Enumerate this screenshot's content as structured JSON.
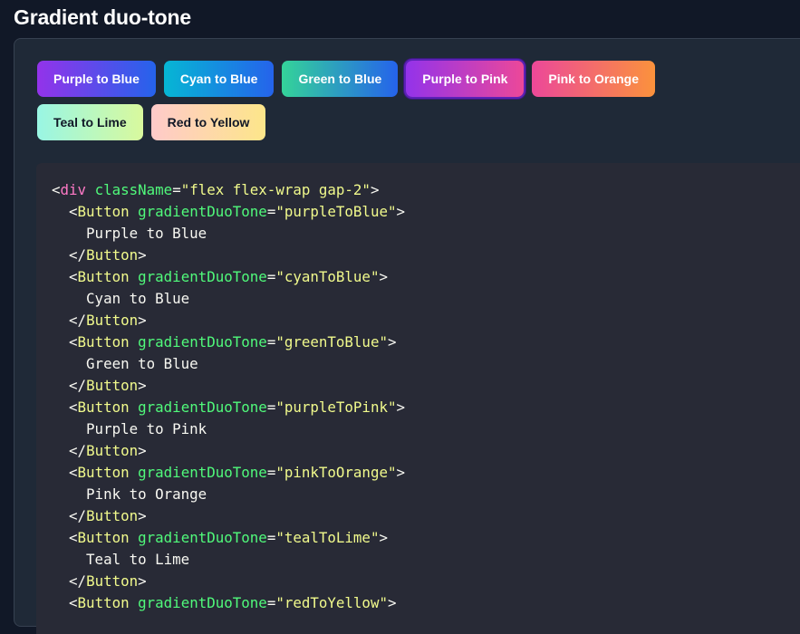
{
  "page": {
    "title": "Gradient duo-tone"
  },
  "buttons": [
    {
      "label": "Purple to Blue",
      "gradient": [
        "#9333ea",
        "#2563eb"
      ],
      "text_color": "#ffffff"
    },
    {
      "label": "Cyan to Blue",
      "gradient": [
        "#06b6d4",
        "#2563eb"
      ],
      "text_color": "#ffffff"
    },
    {
      "label": "Green to Blue",
      "gradient": [
        "#34d399",
        "#2563eb"
      ],
      "text_color": "#ffffff"
    },
    {
      "label": "Purple to Pink",
      "gradient": [
        "#9333ea",
        "#ec4899"
      ],
      "text_color": "#ffffff",
      "focused": true
    },
    {
      "label": "Pink to Orange",
      "gradient": [
        "#ec4899",
        "#fb923c"
      ],
      "text_color": "#ffffff"
    },
    {
      "label": "Teal to Lime",
      "gradient": [
        "#99f6e4",
        "#d9f99d"
      ],
      "text_color": "#111827"
    },
    {
      "label": "Red to Yellow",
      "gradient": [
        "#fecaca",
        "#fde68a"
      ],
      "text_color": "#111827"
    }
  ],
  "code": {
    "open_tag": "div",
    "open_attr": "className",
    "open_value": "\"flex flex-wrap gap-2\"",
    "component": "Button",
    "prop": "gradientDuoTone",
    "items": [
      {
        "value": "\"purpleToBlue\"",
        "text": "Purple to Blue"
      },
      {
        "value": "\"cyanToBlue\"",
        "text": "Cyan to Blue"
      },
      {
        "value": "\"greenToBlue\"",
        "text": "Green to Blue"
      },
      {
        "value": "\"purpleToPink\"",
        "text": "Purple to Pink"
      },
      {
        "value": "\"pinkToOrange\"",
        "text": "Pink to Orange"
      },
      {
        "value": "\"tealToLime\"",
        "text": "Teal to Lime"
      },
      {
        "value": "\"redToYellow\"",
        "text": ""
      }
    ]
  }
}
